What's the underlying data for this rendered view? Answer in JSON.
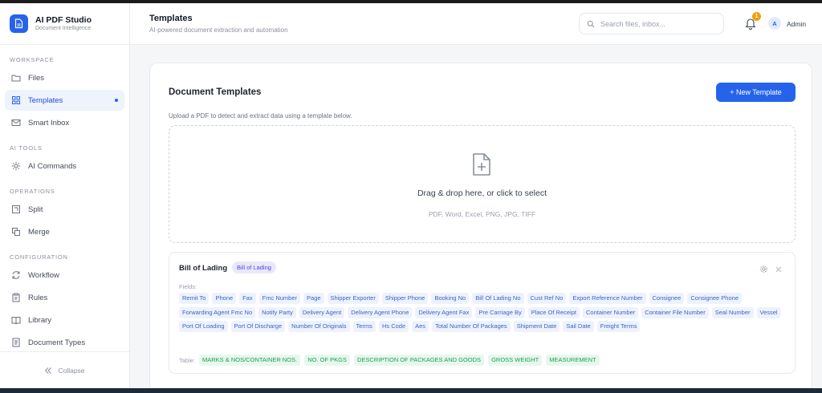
{
  "app": {
    "name": "AI PDF Studio",
    "subtitle": "Document Intelligence"
  },
  "sidebar": {
    "sections": [
      {
        "label": "WORKSPACE",
        "items": [
          {
            "label": "Files",
            "icon": "folder-icon",
            "active": false
          },
          {
            "label": "Templates",
            "icon": "grid-icon",
            "active": true
          },
          {
            "label": "Smart Inbox",
            "icon": "mail-icon",
            "active": false
          }
        ]
      },
      {
        "label": "AI TOOLS",
        "items": [
          {
            "label": "AI Commands",
            "icon": "sparkle-icon",
            "active": false
          }
        ]
      },
      {
        "label": "OPERATIONS",
        "items": [
          {
            "label": "Split",
            "icon": "split-icon",
            "active": false
          },
          {
            "label": "Merge",
            "icon": "merge-icon",
            "active": false
          }
        ]
      },
      {
        "label": "CONFIGURATION",
        "items": [
          {
            "label": "Workflow",
            "icon": "workflow-icon",
            "active": false
          },
          {
            "label": "Rules",
            "icon": "clipboard-icon",
            "active": false
          },
          {
            "label": "Library",
            "icon": "book-icon",
            "active": false
          },
          {
            "label": "Document Types",
            "icon": "document-icon",
            "active": false
          }
        ]
      }
    ],
    "collapse_label": "Collapse"
  },
  "header": {
    "title": "Templates",
    "subtitle": "AI-powered document extraction and automation",
    "search_placeholder": "Search files, inbox...",
    "notification_count": "1",
    "user_initial": "A",
    "user_name": "Admin"
  },
  "main": {
    "card_title": "Document Templates",
    "new_button": "+ New Template",
    "description": "Upload a PDF to detect and extract data using a template below.",
    "dropzone": {
      "title": "Drag & drop here, or click to select",
      "formats": "PDF, Word, Excel, PNG, JPG, TIFF"
    },
    "template": {
      "name": "Bill of Lading",
      "badge": "Bill of Lading",
      "fields_label": "Fields:",
      "fields": [
        "Remit To",
        "Phone",
        "Fax",
        "Fmc Number",
        "Page",
        "Shipper Exporter",
        "Shipper Phone",
        "Booking No",
        "Bill Of Lading No",
        "Cust Ref No",
        "Export Reference Number",
        "Consignee",
        "Consignee Phone",
        "Forwarding Agent Fmc No",
        "Notify Party",
        "Delivery Agent",
        "Delivery Agent Phone",
        "Delivery Agent Fax",
        "Pre Carriage By",
        "Place Of Receipt",
        "Container Number",
        "Container File Number",
        "Seal Number",
        "Vessel",
        "Port Of Loading",
        "Port Of Discharge",
        "Number Of Originals",
        "Terms",
        "Hs Code",
        "Aes",
        "Total Number Of Packages",
        "Shipment Date",
        "Sail Date",
        "Freight Terms"
      ],
      "table_label": "Table:",
      "table_columns": [
        "MARKS & NOS/CONTAINER NOS.",
        "NO. OF PKGS",
        "DESCRIPTION OF PACKAGES AND GOODS",
        "GROSS WEIGHT",
        "MEASUREMENT"
      ]
    }
  },
  "colors": {
    "accent": "#2563eb",
    "badge": "#f59e0b",
    "field_chip_text": "#3b63c7",
    "table_chip_text": "#16a34a"
  }
}
